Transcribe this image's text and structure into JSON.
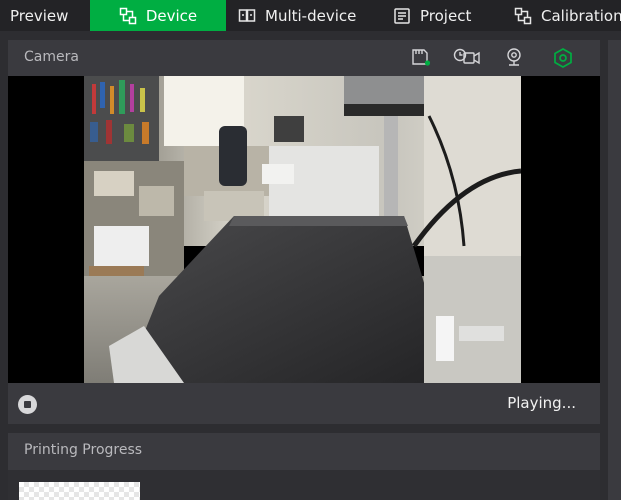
{
  "tabs": {
    "preview": "Preview",
    "device": "Device",
    "multi_device": "Multi-device",
    "project": "Project",
    "calibration": "Calibration"
  },
  "camera": {
    "title": "Camera",
    "status": "Playing...",
    "icons": [
      "sd-card-icon",
      "timelapse-camera-icon",
      "webcam-icon",
      "settings-hex-icon"
    ]
  },
  "progress": {
    "title": "Printing Progress"
  },
  "colors": {
    "accent": "#00ae42",
    "topbar": "#232326",
    "panel": "#3a3a3f"
  }
}
